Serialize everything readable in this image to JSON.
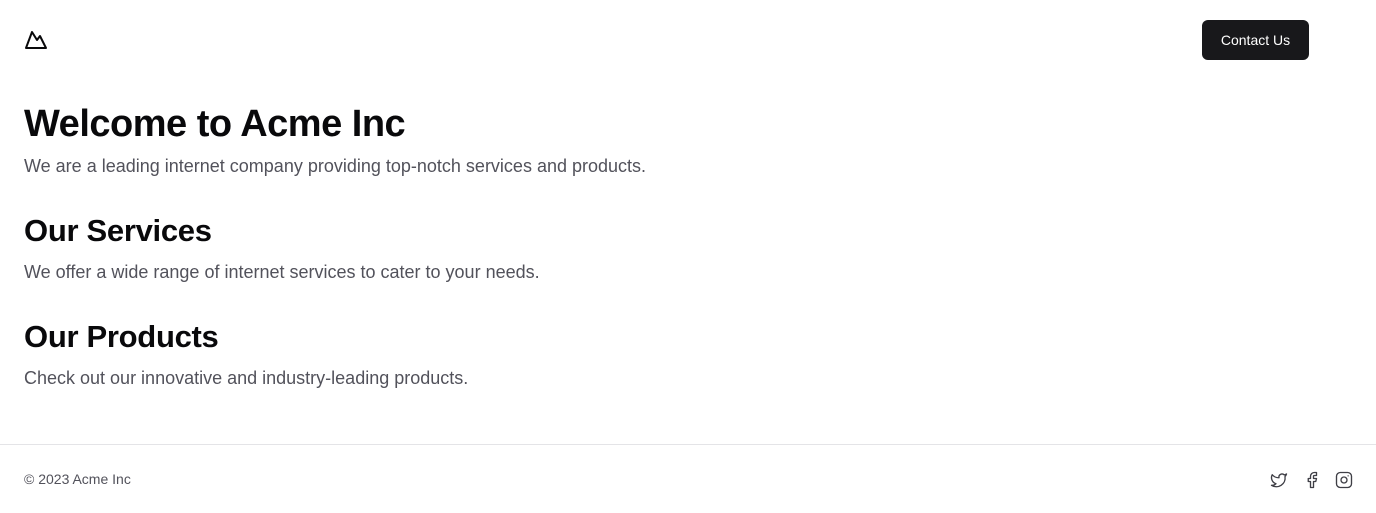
{
  "header": {
    "logo_icon": "mountain-logo-icon",
    "contact_label": "Contact Us"
  },
  "hero": {
    "title": "Welcome to Acme Inc",
    "subtitle": "We are a leading internet company providing top-notch services and products."
  },
  "sections": [
    {
      "title": "Our Services",
      "text": "We offer a wide range of internet services to cater to your needs."
    },
    {
      "title": "Our Products",
      "text": "Check out our innovative and industry-leading products."
    }
  ],
  "footer": {
    "copyright": "© 2023 Acme Inc",
    "social_icons": [
      "twitter-icon",
      "facebook-icon",
      "instagram-icon"
    ]
  },
  "colors": {
    "button_bg": "#18181b",
    "heading": "#09090b",
    "body_text": "#52525b",
    "divider": "#e4e4e7"
  }
}
